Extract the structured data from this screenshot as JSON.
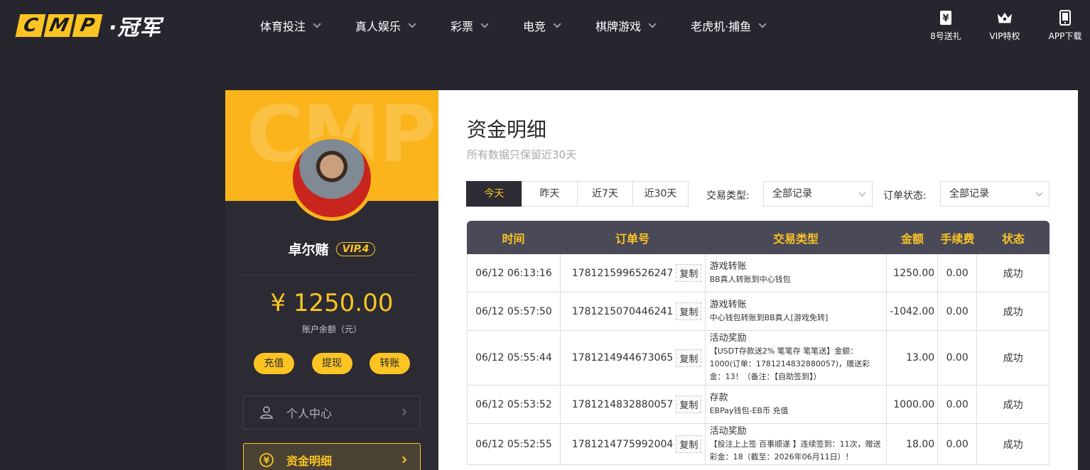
{
  "header": {
    "logo_letters": [
      "C",
      "M",
      "P"
    ],
    "logo_cn": "·冠军",
    "nav": [
      "体育投注",
      "真人娱乐",
      "彩票",
      "电竞",
      "棋牌游戏",
      "老虎机·捕鱼"
    ],
    "right": [
      {
        "label": "8号送礼",
        "icon": "yen-gift-icon"
      },
      {
        "label": "VIP特权",
        "icon": "crown-icon"
      },
      {
        "label": "APP下载",
        "icon": "phone-icon"
      }
    ]
  },
  "sidebar": {
    "watermark": "CMP",
    "username": "卓尔赌",
    "vip": "VIP.4",
    "balance": "¥ 1250.00",
    "balance_label": "账户余额（元）",
    "actions": [
      "充值",
      "提现",
      "转账"
    ],
    "menu": [
      {
        "label": "个人中心",
        "icon": "user-icon",
        "active": false
      },
      {
        "label": "资金明细",
        "icon": "yen-coin-icon",
        "active": true
      }
    ]
  },
  "main": {
    "title": "资金明细",
    "subtitle": "所有数据只保留近30天",
    "tabs": [
      "今天",
      "昨天",
      "近7天",
      "近30天"
    ],
    "filter_type_label": "交易类型:",
    "filter_type_value": "全部记录",
    "filter_status_label": "订单状态:",
    "filter_status_value": "全部记录",
    "columns": [
      "时间",
      "订单号",
      "交易类型",
      "金额",
      "手续费",
      "状态"
    ],
    "copy_label": "复制",
    "rows": [
      {
        "time": "06/12 06:13:16",
        "order": "1781215996526247",
        "type": "游戏转账",
        "desc": "BB真人转账到中心钱包",
        "amount": "1250.00",
        "fee": "0.00",
        "status": "成功"
      },
      {
        "time": "06/12 05:57:50",
        "order": "1781215070446241",
        "type": "游戏转账",
        "desc": "中心钱包转账到BB真人[游戏免转]",
        "amount": "-1042.00",
        "fee": "0.00",
        "status": "成功"
      },
      {
        "time": "06/12 05:55:44",
        "order": "1781214944673065",
        "type": "活动奖励",
        "desc": "【USDT存款送2% 笔笔存 笔笔送】金额：1000(订单：1781214832880057)，赠送彩金：13！（备注：【自助签到】）",
        "amount": "13.00",
        "fee": "0.00",
        "status": "成功"
      },
      {
        "time": "06/12 05:53:52",
        "order": "1781214832880057",
        "type": "存款",
        "desc": "EBPay钱包-EB币 充值",
        "amount": "1000.00",
        "fee": "0.00",
        "status": "成功"
      },
      {
        "time": "06/12 05:52:55",
        "order": "1781214775992004",
        "type": "活动奖励",
        "desc": "【投注上上签 百事顺遂 】连续签到：11次，赠送彩金：18（截至：2026年06月11日）！",
        "amount": "18.00",
        "fee": "0.00",
        "status": "成功"
      }
    ]
  },
  "colors": {
    "accent": "#fbc423",
    "bg": "#27262e",
    "success": "#3a9a3a"
  }
}
